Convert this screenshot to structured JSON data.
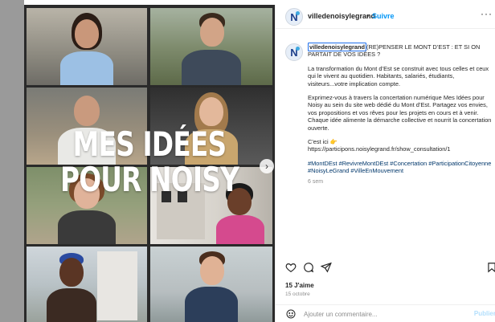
{
  "post": {
    "overlay_title_line1": "MES IDÉES",
    "overlay_title_line2": "POUR NOISY"
  },
  "header": {
    "username": "villedenoisylegrand",
    "separator": "•",
    "follow_label": "Suivre",
    "more_label": "···"
  },
  "caption": {
    "username": "villedenoisylegrand",
    "headline": "(RE)PENSER LE MONT D’EST : ET SI ON PARTAIT DE VOS IDÉES ?",
    "paragraph1": "La transformation du Mont d’Est se construit avec tous celles et ceux qui le vivent au quotidien. Habitants, salariés, étudiants, visiteurs...votre implication compte.",
    "paragraph2": "Exprimez-vous à travers la concertation numérique Mes Idées pour Noisy au sein du site web dédié du Mont d’Est. Partagez vos envies, vos propositions et vos rêves pour les projets en cours et à venir. Chaque idée alimente la démarche collective et nourrit la concertation ouverte.",
    "link_intro": "C'est ici 👉",
    "link": "https://participons.noisylegrand.fr/show_consultation/1",
    "hashtags": "#MontDEst #RevivreMontDEst #Concertation #ParticipationCitoyenne #NoisyLeGrand #VilleEnMouvement",
    "age": "6 sem"
  },
  "engagement": {
    "likes": "15 J'aime",
    "date": "15 octobre"
  },
  "comment": {
    "placeholder": "Ajouter un commentaire...",
    "publish_label": "Publier"
  },
  "colors": {
    "accent": "#0095f6",
    "text": "#262626",
    "muted": "#8e8e8e",
    "hashtag": "#00376b",
    "brand_navy": "#1d3f8a"
  },
  "icons": [
    "heart-icon",
    "comment-icon",
    "share-icon",
    "bookmark-icon",
    "emoji-icon",
    "chevron-right-icon"
  ]
}
